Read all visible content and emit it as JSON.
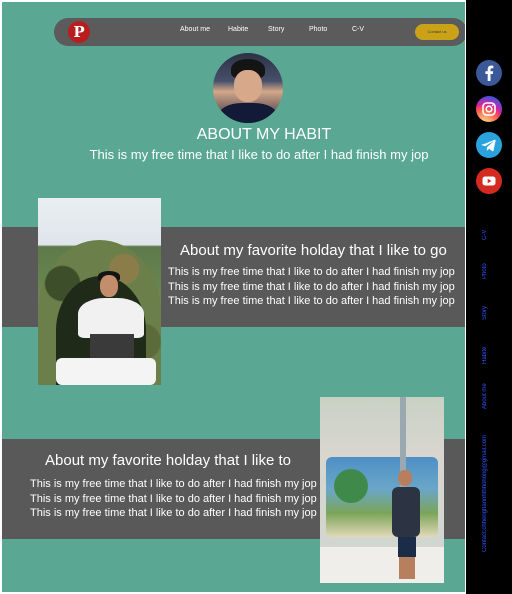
{
  "nav": {
    "logo_glyph": "P",
    "links": [
      "About me",
      "Habite",
      "Story",
      "Photo",
      "C-V"
    ],
    "contact_label": "Contact us"
  },
  "hero": {
    "title": "ABOUT MY HABIT",
    "subtitle": "This is my free time that I like to do after I had finish my jop"
  },
  "section1": {
    "title": "About my favorite holday that I like to go",
    "text": "This is my free time that I like to do after I had finish my jop This is my free time that I like to do after I had finish my jop This is my free time that I like to do after I had finish my jop"
  },
  "section2": {
    "title": "About my favorite holday that I like to",
    "text": "This is my free time that I like to do after I had finish my jop This is my free time that I like to do after I had finish my jop This is my free time that I like to do after I had finish my jop"
  },
  "sidebar": {
    "icons": [
      "facebook-icon",
      "instagram-icon",
      "telegram-icon",
      "youtube-icon"
    ],
    "links": [
      "C-V",
      "Photo",
      "Story",
      "Habite",
      "About me"
    ],
    "contact": "Contact:chhenghannhthhohong@gmail.com"
  },
  "colors": {
    "page_bg": "#5aa894",
    "band": "#595959",
    "nav": "#5b5b5b",
    "contact_button": "#c9a218",
    "sidebar": "#000000",
    "sidebar_link": "#2d56ff"
  }
}
